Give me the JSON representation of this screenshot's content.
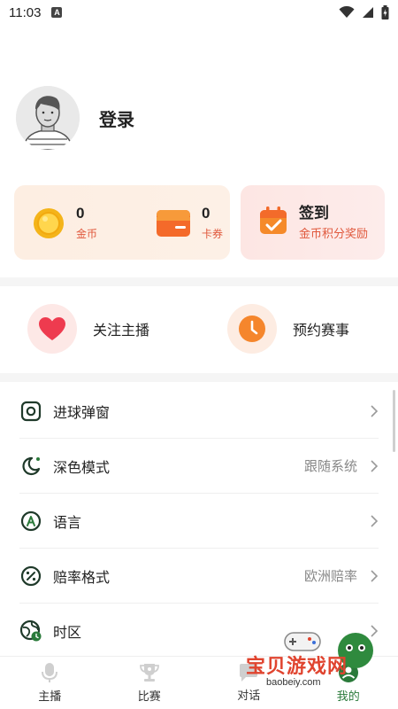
{
  "status_bar": {
    "time": "11:03",
    "notification_glyph": "A"
  },
  "profile": {
    "login_label": "登录"
  },
  "wallet": {
    "coins": {
      "value": "0",
      "label": "金币"
    },
    "cards": {
      "value": "0",
      "label": "卡券"
    }
  },
  "sign_in": {
    "title": "签到",
    "subtitle": "金币积分奖励"
  },
  "quick_actions": {
    "follow_streamer": "关注主播",
    "reserve_match": "预约赛事"
  },
  "menu": {
    "goal_popup": {
      "label": "进球弹窗"
    },
    "dark_mode": {
      "label": "深色模式",
      "value": "跟随系统"
    },
    "language": {
      "label": "语言"
    },
    "odds_format": {
      "label": "赔率格式",
      "value": "欧洲赔率"
    },
    "timezone": {
      "label": "时区"
    }
  },
  "tabbar": {
    "streamer": "主播",
    "match": "比赛",
    "chat": "对话",
    "mine": "我的"
  },
  "watermark": {
    "text": "宝贝游戏网",
    "url": "baobeiy.com"
  },
  "colors": {
    "accent_green": "#2a7a3a",
    "accent_orange": "#e0583c",
    "page_bg": "#ffffff"
  }
}
